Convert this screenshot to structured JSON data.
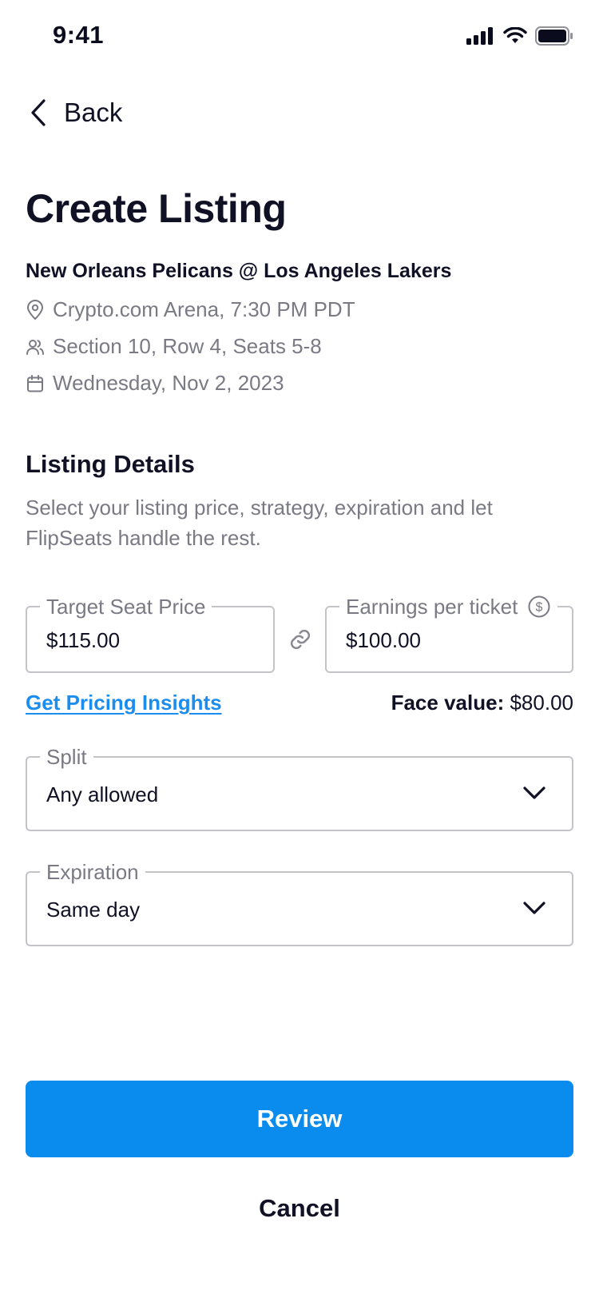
{
  "status_bar": {
    "time": "9:41",
    "icons": [
      "signal-icon",
      "wifi-icon",
      "battery-icon"
    ]
  },
  "nav": {
    "back_label": "Back"
  },
  "page": {
    "title": "Create Listing"
  },
  "event": {
    "name": "New Orleans Pelicans @ Los Angeles Lakers",
    "venue": "Crypto.com Arena, 7:30 PM PDT",
    "seats": "Section 10, Row 4, Seats 5-8",
    "date": "Wednesday, Nov 2, 2023"
  },
  "listing_details": {
    "title": "Listing Details",
    "description": "Select your listing price, strategy, expiration and let FlipSeats handle the rest."
  },
  "pricing": {
    "target_label": "Target Seat Price",
    "target_value": "$115.00",
    "earnings_label": "Earnings per ticket",
    "earnings_value": "$100.00",
    "insights_link": "Get Pricing Insights",
    "face_value_label": "Face value:",
    "face_value_amount": "$80.00"
  },
  "split": {
    "label": "Split",
    "value": "Any allowed"
  },
  "expiration": {
    "label": "Expiration",
    "value": "Same day"
  },
  "actions": {
    "review_label": "Review",
    "cancel_label": "Cancel"
  },
  "colors": {
    "accent": "#0a8cef",
    "link": "#1a8def",
    "text": "#111126",
    "muted": "#7a7a84"
  }
}
